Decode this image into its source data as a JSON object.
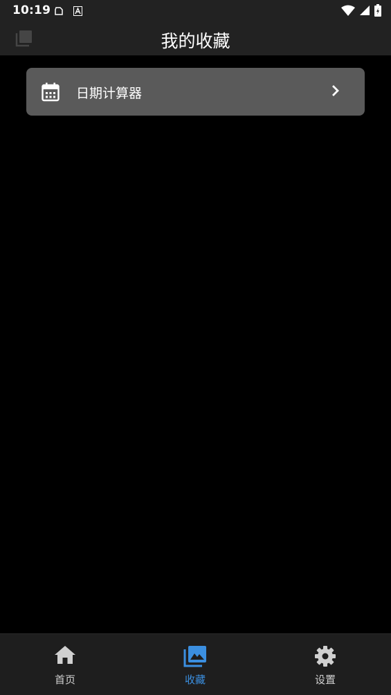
{
  "status_bar": {
    "time": "10:19"
  },
  "app_bar": {
    "title": "我的收藏"
  },
  "favorites": [
    {
      "label": "日期计算器",
      "icon": "calendar-icon"
    }
  ],
  "bottom_nav": {
    "items": [
      {
        "label": "首页",
        "icon": "home-icon",
        "active": false
      },
      {
        "label": "收藏",
        "icon": "photo-library-icon",
        "active": true
      },
      {
        "label": "设置",
        "icon": "gear-icon",
        "active": false
      }
    ]
  },
  "colors": {
    "background": "#000000",
    "bar": "#222222",
    "card": "#5a5a5a",
    "accent": "#3b8fe0",
    "nav_inactive": "#d0d0d0"
  }
}
